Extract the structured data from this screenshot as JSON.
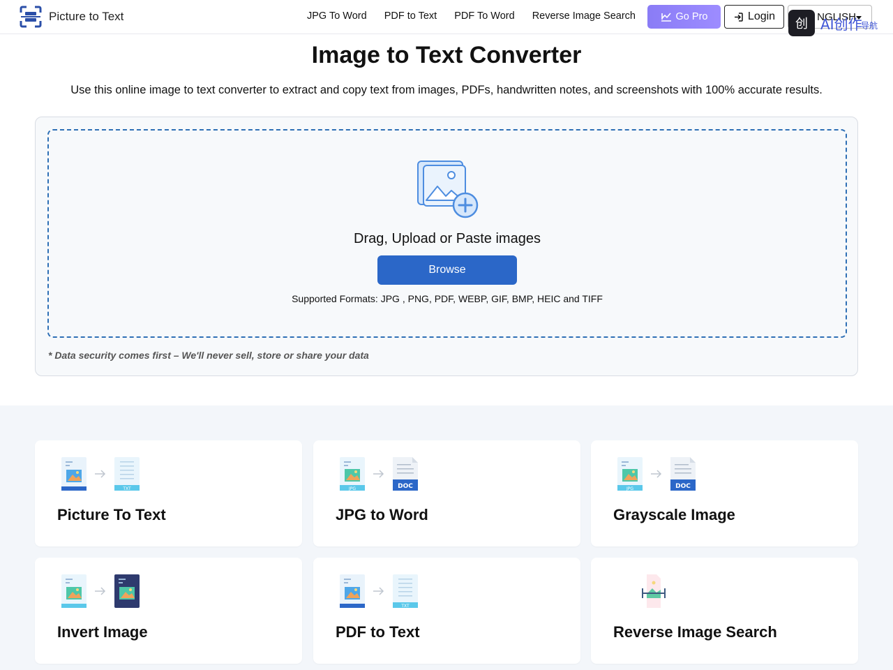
{
  "header": {
    "logo_text": "Picture to Text",
    "nav": [
      "JPG To Word",
      "PDF to Text",
      "PDF To Word",
      "Reverse Image Search"
    ],
    "go_pro_label": "Go Pro",
    "login_label": "Login",
    "language_label": "NGLISH",
    "ai_badge_text": "AI创作",
    "ai_badge_sub": "导航",
    "ai_badge_mark": "创"
  },
  "hero": {
    "title": "Image to Text Converter",
    "subtitle": "Use this online image to text converter to extract and copy text from images, PDFs, handwritten notes, and screenshots with 100% accurate results."
  },
  "upload": {
    "drag_text": "Drag, Upload or Paste images",
    "browse_label": "Browse",
    "formats_text": "Supported Formats: JPG , PNG, PDF, WEBP, GIF, BMP, HEIC and TIFF",
    "security_note": "* Data security comes first – We'll never sell, store or share your data"
  },
  "tools": [
    {
      "label": "Picture To Text",
      "from": "image",
      "to": "TXT"
    },
    {
      "label": "JPG to Word",
      "from": "JPG",
      "to": "DOC"
    },
    {
      "label": "Grayscale Image",
      "from": "JPG",
      "to": "DOC"
    },
    {
      "label": "Invert Image",
      "from": "image",
      "to": "inverted"
    },
    {
      "label": "PDF to Text",
      "from": "image",
      "to": "TXT"
    },
    {
      "label": "Reverse Image Search",
      "from": "scan",
      "to": ""
    }
  ],
  "colors": {
    "brand_blue": "#2b67c8",
    "go_pro_purple": "#8a7cf6",
    "dropzone_border": "#2e6fb5"
  }
}
